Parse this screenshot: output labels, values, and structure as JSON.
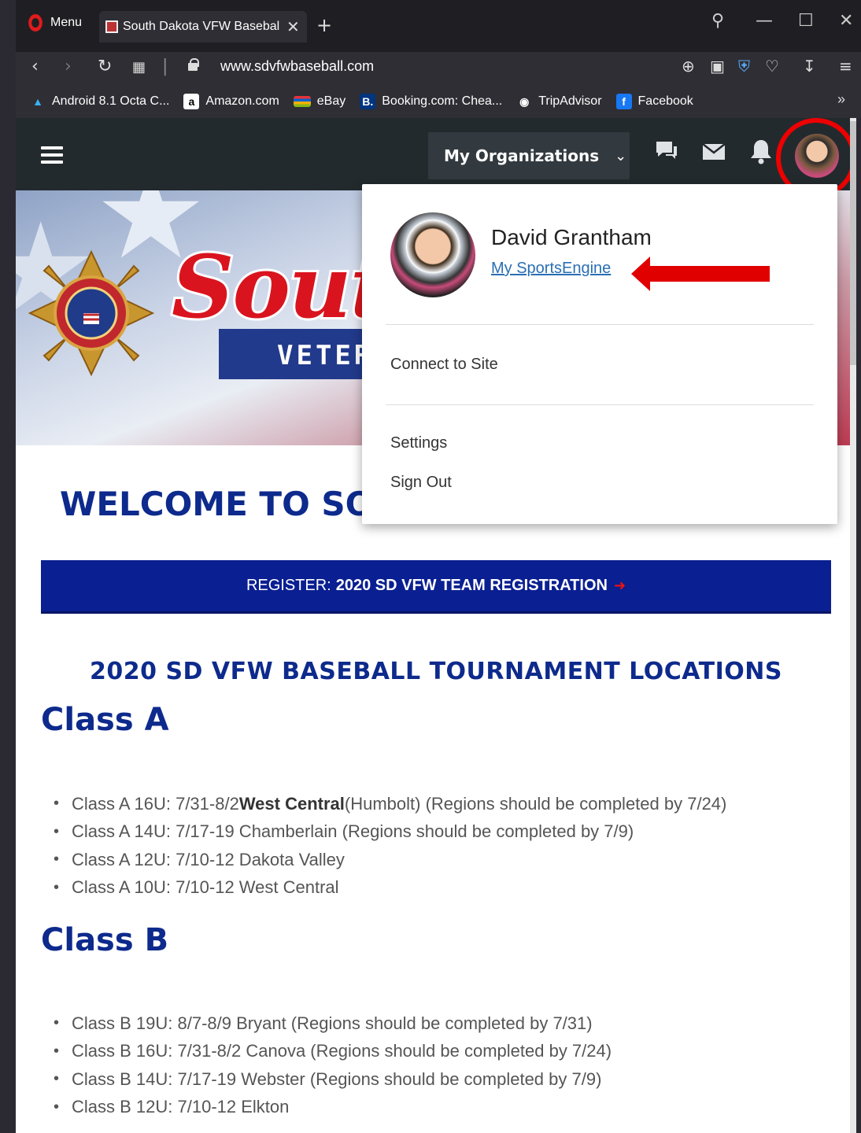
{
  "browser": {
    "menu_label": "Menu",
    "tab_title": "South Dakota VFW Basebal",
    "url": "www.sdvfwbaseball.com",
    "bookmarks": [
      {
        "label": "Android 8.1 Octa C...",
        "icon": "android-icon"
      },
      {
        "label": "Amazon.com",
        "icon": "amazon-icon"
      },
      {
        "label": "eBay",
        "icon": "ebay-icon"
      },
      {
        "label": "Booking.com: Chea...",
        "icon": "booking-icon"
      },
      {
        "label": "TripAdvisor",
        "icon": "tripadvisor-icon"
      },
      {
        "label": "Facebook",
        "icon": "facebook-icon"
      }
    ]
  },
  "site_header": {
    "org_menu_label": "My Organizations",
    "icons": [
      "chat-icon",
      "mail-icon",
      "bell-icon",
      "avatar"
    ]
  },
  "banner": {
    "title_text": "Sout",
    "subtitle_text": "VETER"
  },
  "user_menu": {
    "name": "David Grantham",
    "profile_link": "My SportsEngine",
    "items": [
      "Connect to Site",
      "Settings",
      "Sign Out"
    ]
  },
  "main": {
    "welcome": "WELCOME TO SOU",
    "register_prefix": "REGISTER:",
    "register_link": "2020 SD VFW TEAM REGISTRATION",
    "locations_heading": "2020 SD VFW BASEBALL TOURNAMENT LOCATIONS",
    "class_a_heading": "Class A",
    "class_a_items": [
      {
        "pre": "Class A 16U: 7/31-8/2 ",
        "bold": "West Central",
        "post": " (Humbolt) (Regions should be completed by 7/24)"
      },
      {
        "pre": "Class A 14U: 7/17-19 Chamberlain (Regions should be completed by 7/9)",
        "bold": "",
        "post": ""
      },
      {
        "pre": "Class A 12U: 7/10-12 Dakota Valley",
        "bold": "",
        "post": ""
      },
      {
        "pre": "Class A 10U: 7/10-12 West Central",
        "bold": "",
        "post": ""
      }
    ],
    "class_b_heading": "Class B",
    "class_b_items": [
      "Class B 19U: 8/7-8/9 Bryant (Regions should be completed by 7/31)",
      "Class B 16U: 7/31-8/2 Canova (Regions should be completed by 7/24)",
      "Class B 14U: 7/17-19 Webster (Regions should be completed by 7/9)",
      "Class B 12U: 7/10-12 Elkton"
    ]
  },
  "colors": {
    "brand_blue": "#0d2a8c",
    "register_bar": "#0a1f91",
    "annotation_red": "#e00000"
  }
}
